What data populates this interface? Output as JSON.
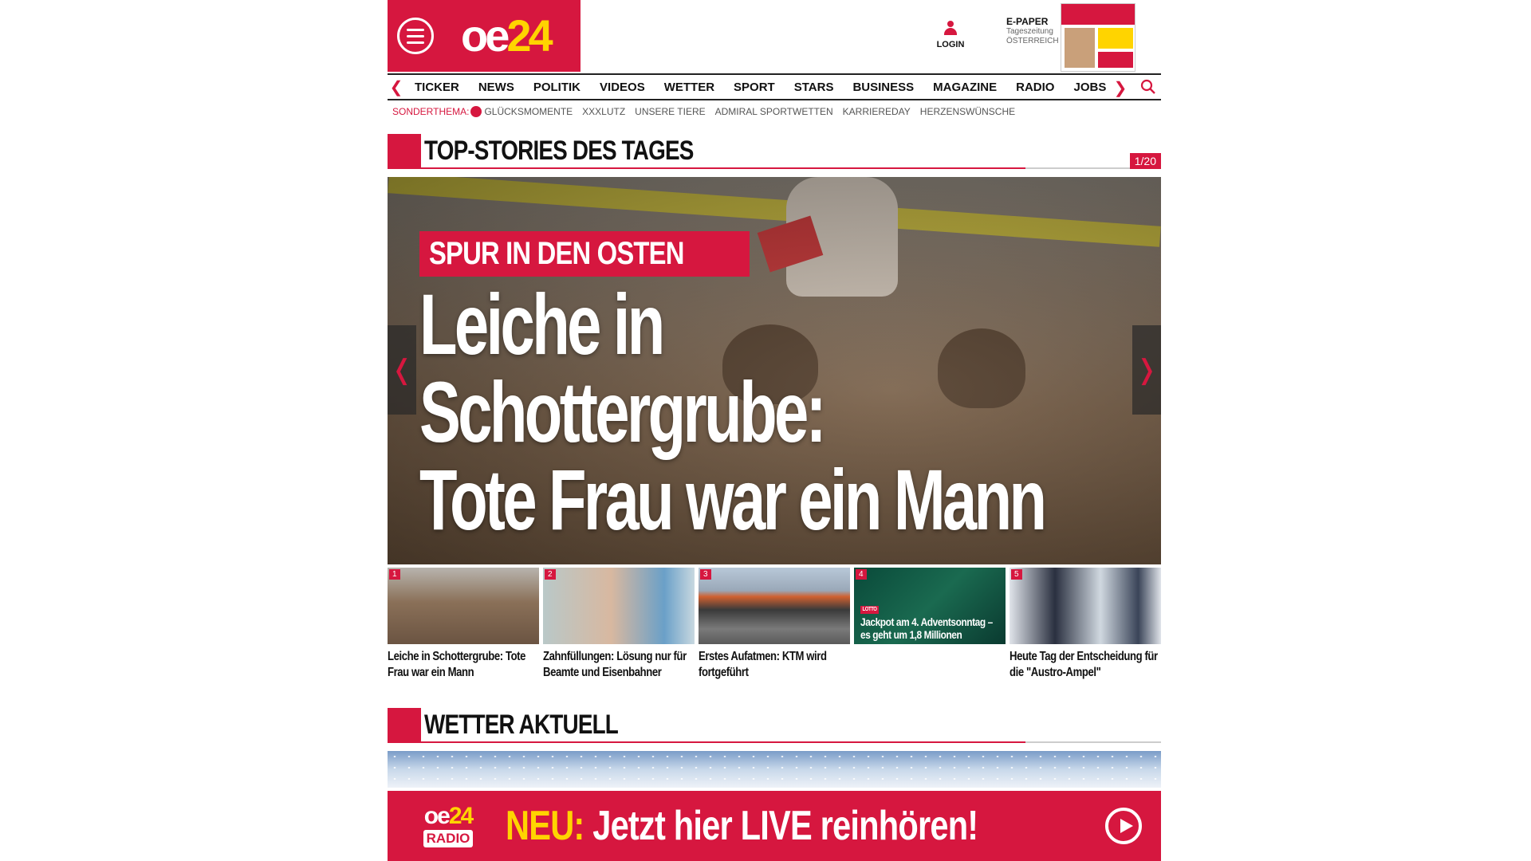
{
  "header": {
    "logo": {
      "text_main": "oe",
      "text_accent": "24"
    },
    "menu_icon": "hamburger-menu-icon",
    "login_label": "LOGIN",
    "epaper": {
      "title": "E-PAPER",
      "subtitle1": "Tageszeitung",
      "subtitle2": "ÖSTERREICH"
    }
  },
  "nav": {
    "items": [
      "TICKER",
      "NEWS",
      "POLITIK",
      "VIDEOS",
      "WETTER",
      "SPORT",
      "STARS",
      "BUSINESS",
      "MAGAZINE",
      "RADIO",
      "JOBS"
    ],
    "prev_icon": "chevron-left-icon",
    "next_icon": "chevron-right-icon",
    "search_icon": "search-icon"
  },
  "sub_nav": {
    "label": "SONDERTHEMA:",
    "items": [
      "GLÜCKSMOMENTE",
      "XXXLUTZ",
      "UNSERE TIERE",
      "ADMIRAL SPORTWETTEN",
      "KARRIEREDAY",
      "HERZENSWÜNSCHE"
    ]
  },
  "top_stories": {
    "title": "TOP-STORIES DES TAGES",
    "counter": "1/20",
    "hero": {
      "kicker": "SPUR IN DEN OSTEN",
      "headline_line1": "Leiche in",
      "headline_line2": "Schottergrube:",
      "headline_line3": "Tote Frau war ein Mann",
      "prev_arrow": "❬",
      "next_arrow": "❭"
    },
    "teasers": [
      {
        "num": "1",
        "caption": "Leiche in Schottergrube: Tote Frau war ein Mann",
        "overlay": "",
        "tag": ""
      },
      {
        "num": "2",
        "caption": "Zahnfüllungen: Lösung nur für Beamte und Eisenbahner",
        "overlay": "",
        "tag": ""
      },
      {
        "num": "3",
        "caption": "Erstes Aufatmen: KTM wird fortgeführt",
        "overlay": "",
        "tag": ""
      },
      {
        "num": "4",
        "caption": "",
        "overlay": "Jackpot am 4. Adventsonntag – es geht um 1,8 Millionen",
        "tag": "LOTTO"
      },
      {
        "num": "5",
        "caption": "Heute Tag der Entscheidung für die \"Austro-Ampel\"",
        "overlay": "",
        "tag": ""
      }
    ]
  },
  "weather": {
    "title": "WETTER AKTUELL"
  },
  "radio_banner": {
    "logo_main": "oe",
    "logo_accent": "24",
    "logo_badge": "RADIO",
    "neu": "NEU:",
    "text": "Jetzt hier LIVE reinhören!",
    "play_icon": "play-icon"
  },
  "colors": {
    "brand_red": "#d6173f",
    "accent_yellow": "#ffd400"
  }
}
